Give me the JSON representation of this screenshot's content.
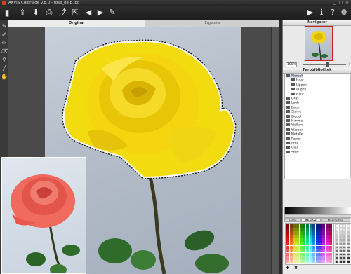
{
  "window": {
    "title": "AKVIS Coloriage v.8.0 - rose_gelb.jpg",
    "minimize": "_",
    "maximize": "□",
    "close": "✕"
  },
  "toolbar": {
    "left_icons": [
      "open-icon",
      "save-icon",
      "print-icon",
      "export-icon",
      "share-icon",
      "undo-icon",
      "redo-icon",
      "settings-icon"
    ],
    "right_icons": [
      "run-icon",
      "info-icon",
      "help-icon",
      "preferences-icon"
    ]
  },
  "tools": [
    "pencil-icon",
    "magic-pencil-icon",
    "keep-color-icon",
    "eraser-icon",
    "color-dropper-icon",
    "brush-icon",
    "hand-icon"
  ],
  "tabs": {
    "original": "Original",
    "result": "Ergebnis"
  },
  "navigator": {
    "title": "Navigator",
    "zoom": "100%"
  },
  "color_library": {
    "title": "Farbbibliothek",
    "items": [
      {
        "label": "Mensch",
        "level": 0,
        "selected": true
      },
      {
        "label": "Haar",
        "level": 1
      },
      {
        "label": "Lippen",
        "level": 1
      },
      {
        "label": "Augen",
        "level": 1
      },
      {
        "label": "Haut",
        "level": 1
      },
      {
        "label": "Gras",
        "level": 0
      },
      {
        "label": "Laub",
        "level": 0
      },
      {
        "label": "Baum",
        "level": 0
      },
      {
        "label": "Steine",
        "level": 0
      },
      {
        "label": "Ziegel",
        "level": 0
      },
      {
        "label": "Himmel",
        "level": 0
      },
      {
        "label": "Wolken",
        "level": 0
      },
      {
        "label": "Wasser",
        "level": 0
      },
      {
        "label": "Metalle",
        "level": 0
      },
      {
        "label": "Papier",
        "level": 0
      },
      {
        "label": "Erde",
        "level": 0
      },
      {
        "label": "Glas",
        "level": 0
      },
      {
        "label": "Stoff",
        "level": 0
      }
    ]
  },
  "color_tabs": [
    "Farbe",
    "Muster",
    "Multifarben"
  ],
  "colors": {
    "accent": "#c22222",
    "photo_bg": "#b7c0cc"
  }
}
